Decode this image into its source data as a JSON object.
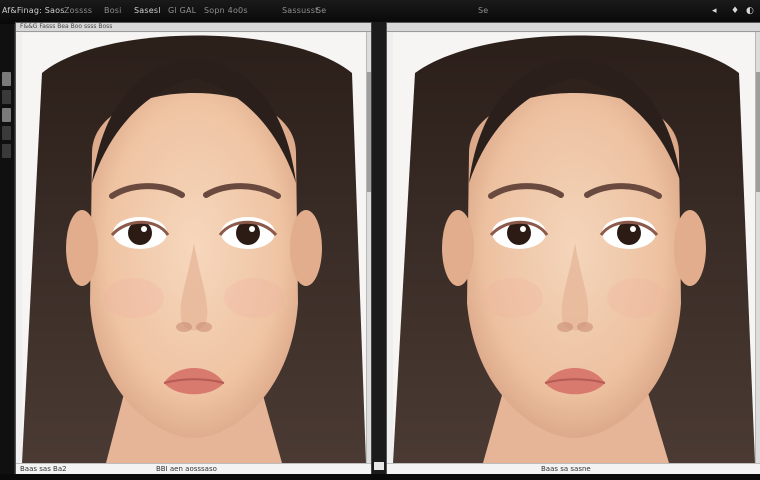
{
  "menubar": {
    "items": [
      {
        "label": "Af&Finag: Saos"
      },
      {
        "label": "Zossss"
      },
      {
        "label": "Bosi"
      },
      {
        "label": "Sasesl"
      },
      {
        "label": "Gl GAL"
      },
      {
        "label": "Sopn 4o0s"
      },
      {
        "label": "Sassusst"
      },
      {
        "label": "Se"
      },
      {
        "label": "Se"
      }
    ],
    "controls": [
      "◂",
      "♦",
      "◐"
    ]
  },
  "toolstrip": {
    "tools": [
      "tool-1",
      "tool-2",
      "tool-3",
      "tool-4",
      "tool-5"
    ]
  },
  "docs": [
    {
      "name": "left",
      "title": "F&&G Fasss Bea  Boo ssss  Boss",
      "status": {
        "left": "Baas sas  Ba2",
        "right": "BBI aen aosssaso"
      }
    },
    {
      "name": "right",
      "title": "",
      "status": {
        "left": "",
        "right": "Baas sa sasne"
      }
    }
  ],
  "colors": {
    "background": "#0c0c0c",
    "window": "#efefef",
    "skin": "#f2c9a8",
    "hair": "#3a2a22",
    "lips": "#d97a6e"
  }
}
